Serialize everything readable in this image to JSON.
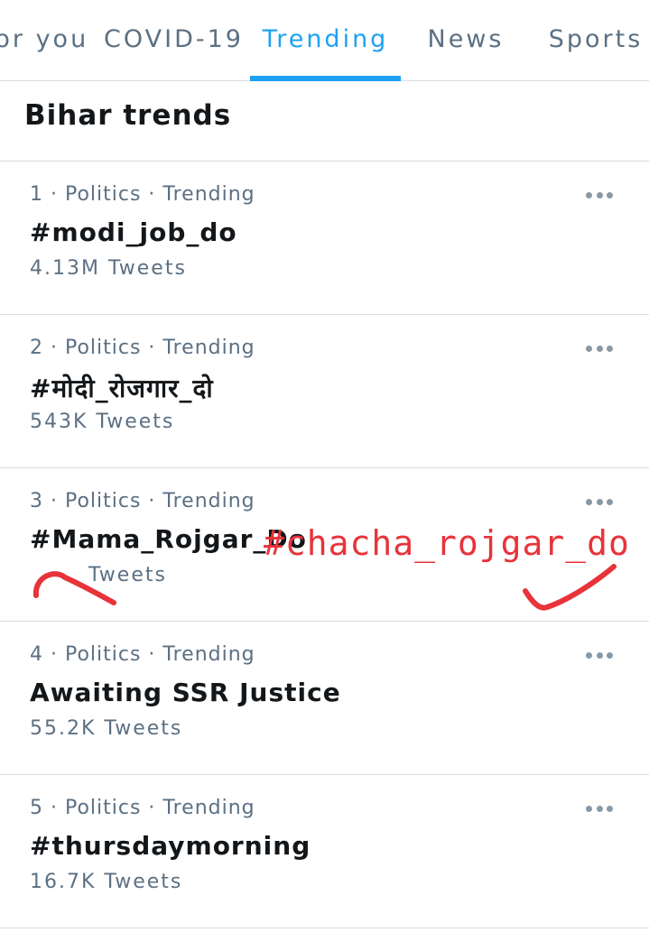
{
  "tabs": [
    {
      "label": "For you",
      "active": false
    },
    {
      "label": "COVID-19",
      "active": false
    },
    {
      "label": "Trending",
      "active": true
    },
    {
      "label": "News",
      "active": false
    },
    {
      "label": "Sports",
      "active": false
    }
  ],
  "section": {
    "title": "Bihar trends"
  },
  "trends": [
    {
      "meta": "1 · Politics · Trending",
      "name": "#modi_job_do",
      "count": "4.13M Tweets"
    },
    {
      "meta": "2 · Politics · Trending",
      "name": "#मोदी_रोजगार_दो",
      "count": "543K Tweets"
    },
    {
      "meta": "3 · Politics · Trending",
      "name": "#Mama_Rojgar_Do",
      "count": "Tweets"
    },
    {
      "meta": "4 · Politics · Trending",
      "name": "Awaiting SSR Justice",
      "count": "55.2K Tweets"
    },
    {
      "meta": "5 · Politics · Trending",
      "name": "#thursdaymorning",
      "count": "16.7K Tweets"
    }
  ],
  "annotation": {
    "text": "#chacha_rojgar_do",
    "color": "#e8333a"
  },
  "colors": {
    "accent": "#1da1f2",
    "muted": "#5b7083",
    "divider": "#d6dde2"
  }
}
